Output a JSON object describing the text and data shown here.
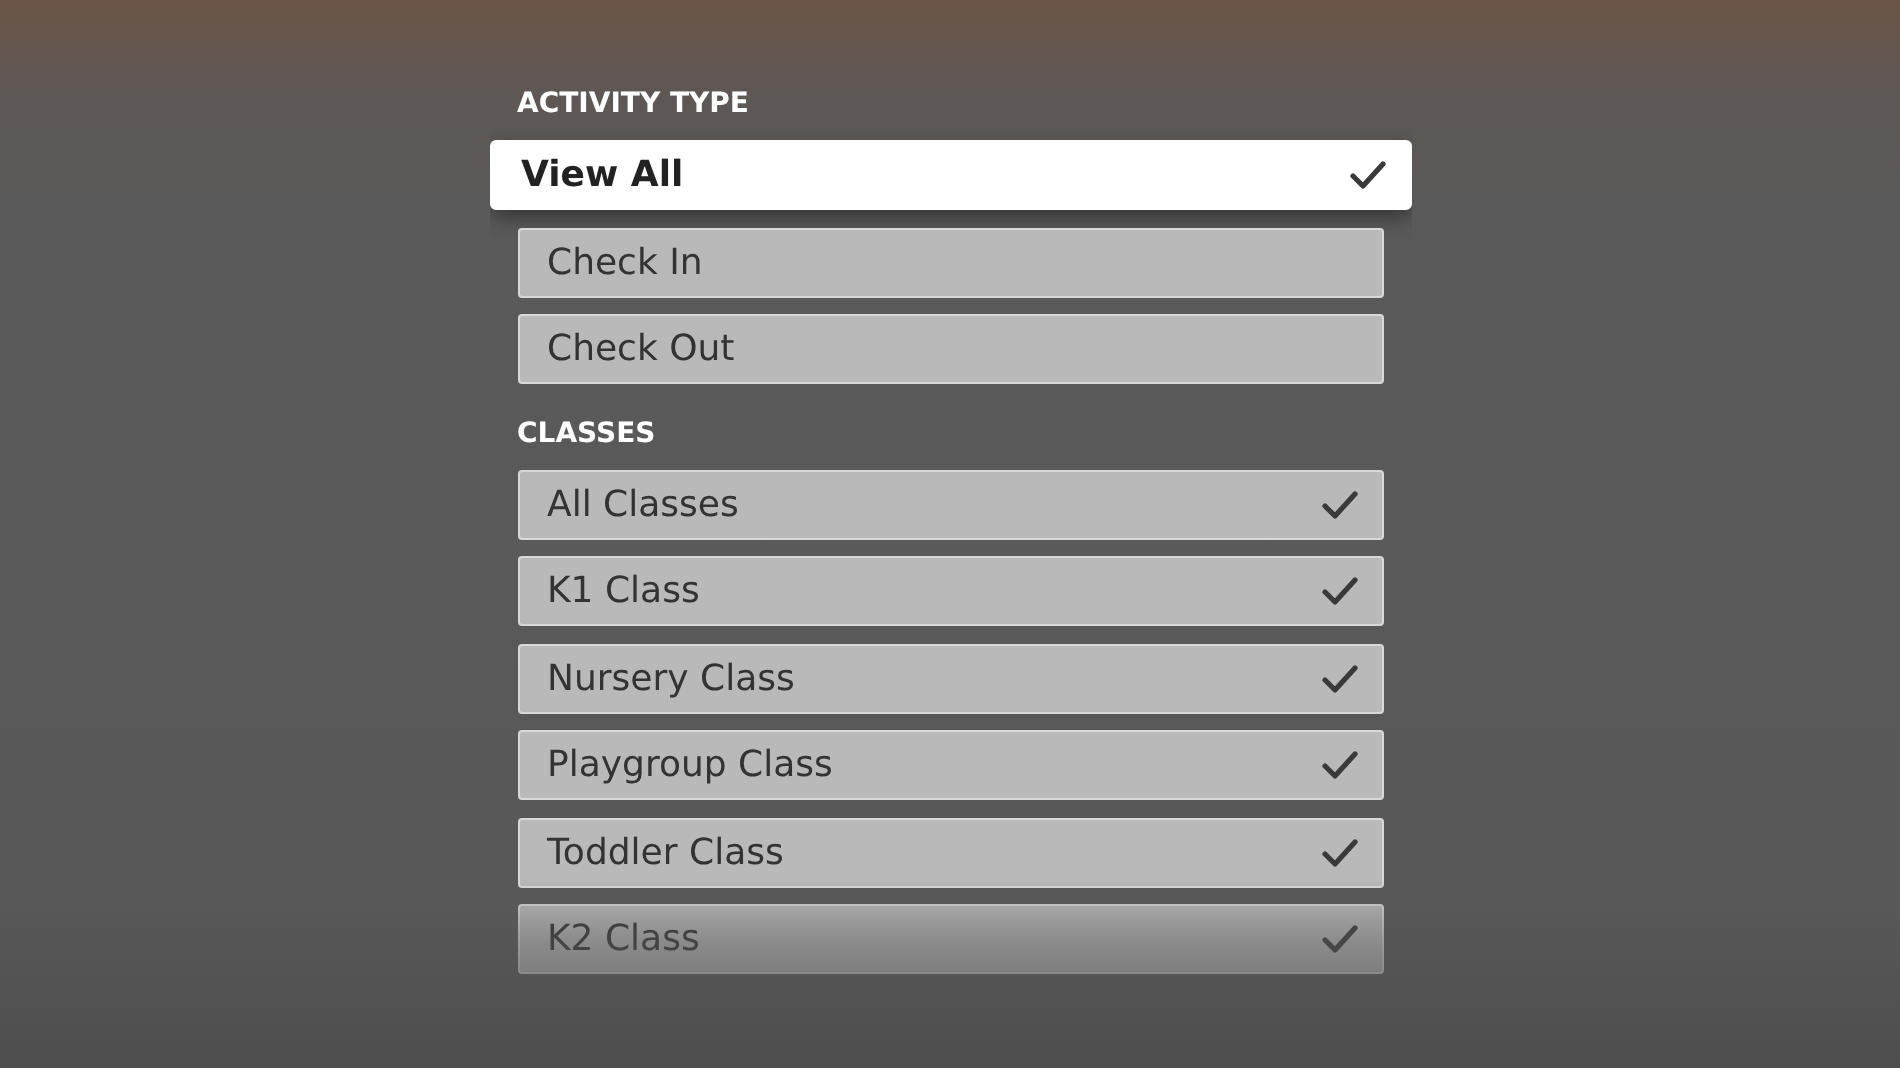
{
  "sections": [
    {
      "title": "ACTIVITY TYPE",
      "items": [
        {
          "label": "View All",
          "checked": true,
          "selected": true
        },
        {
          "label": "Check In",
          "checked": false,
          "selected": false
        },
        {
          "label": "Check Out",
          "checked": false,
          "selected": false
        }
      ]
    },
    {
      "title": "CLASSES",
      "items": [
        {
          "label": "All Classes",
          "checked": true,
          "selected": false
        },
        {
          "label": "K1 Class",
          "checked": true,
          "selected": false
        },
        {
          "label": "Nursery Class",
          "checked": true,
          "selected": false
        },
        {
          "label": "Playgroup Class",
          "checked": true,
          "selected": false
        },
        {
          "label": "Toddler Class",
          "checked": true,
          "selected": false
        },
        {
          "label": "K2 Class",
          "checked": true,
          "selected": false
        }
      ]
    }
  ]
}
